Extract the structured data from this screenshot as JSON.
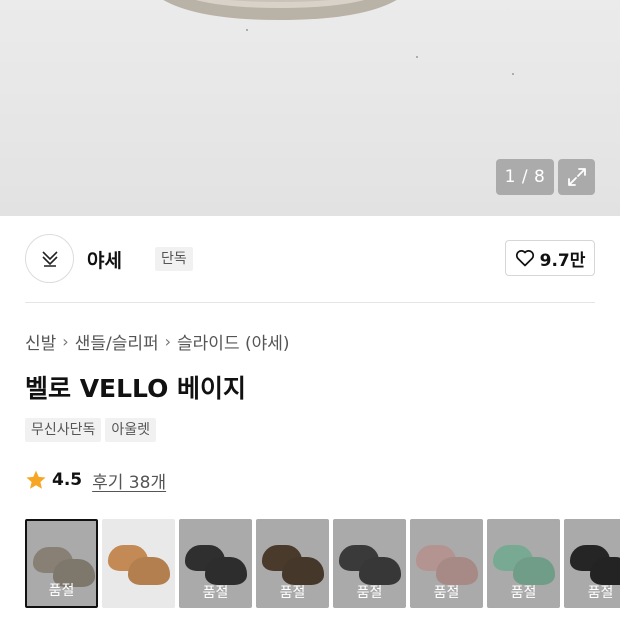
{
  "gallery": {
    "counter": "1 / 8"
  },
  "brand": {
    "name": "야세",
    "badge": "단독",
    "likes": "9.7만"
  },
  "breadcrumb": [
    "신발",
    "샌들/슬리퍼",
    "슬라이드 (야세)"
  ],
  "product": {
    "title": "벨로 VELLO 베이지",
    "tags": [
      "무신사단독",
      "아울렛"
    ],
    "rating": "4.5",
    "reviews": "후기 38개"
  },
  "variants": [
    {
      "color": "#a59a89",
      "label": "품절",
      "soldout": true,
      "selected": true
    },
    {
      "color": "#c48a55",
      "label": "",
      "soldout": false,
      "selected": false
    },
    {
      "color": "#2a2a2a",
      "label": "품절",
      "soldout": true,
      "selected": false
    },
    {
      "color": "#4e3a26",
      "label": "품절",
      "soldout": true,
      "selected": false
    },
    {
      "color": "#3a3a3a",
      "label": "품절",
      "soldout": true,
      "selected": false
    },
    {
      "color": "#e2b6b1",
      "label": "품절",
      "soldout": true,
      "selected": false
    },
    {
      "color": "#8fd4b4",
      "label": "품절",
      "soldout": true,
      "selected": false
    },
    {
      "color": "#1c1c1c",
      "label": "품절",
      "soldout": true,
      "selected": false
    }
  ],
  "icons": {
    "like": "heart-icon",
    "rating": "star-icon",
    "expand": "expand-icon",
    "separator": "chevron-right-icon"
  },
  "colors": {
    "star": "#f6a623"
  }
}
